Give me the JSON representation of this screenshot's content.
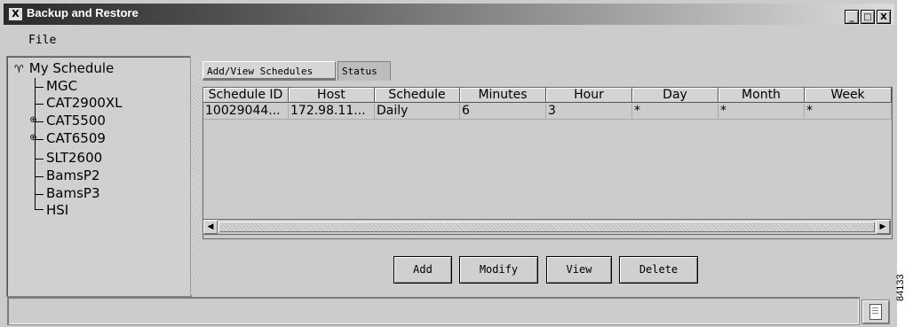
{
  "window": {
    "title": "Backup and Restore",
    "app_icon": "X",
    "controls": {
      "minimize": "_",
      "maximize": "□",
      "close": "X"
    }
  },
  "menubar": {
    "items": [
      {
        "label": "File"
      }
    ]
  },
  "tree": {
    "root": {
      "label": "My Schedule",
      "icon": "folder-open-icon"
    },
    "children": [
      {
        "label": "MGC",
        "expandable": false
      },
      {
        "label": "CAT2900XL",
        "expandable": false
      },
      {
        "label": "CAT5500",
        "expandable": true
      },
      {
        "label": "CAT6509",
        "expandable": true
      },
      {
        "label": "SLT2600",
        "expandable": false
      },
      {
        "label": "BamsP2",
        "expandable": false
      },
      {
        "label": "BamsP3",
        "expandable": false
      },
      {
        "label": "HSI",
        "expandable": false
      }
    ]
  },
  "tabs": [
    {
      "label": "Add/View Schedules",
      "active": true
    },
    {
      "label": "Status",
      "active": false
    }
  ],
  "table": {
    "columns": [
      "Schedule ID",
      "Host",
      "Schedule",
      "Minutes",
      "Hour",
      "Day",
      "Month",
      "Week"
    ],
    "rows": [
      [
        "10029044...",
        "172.98.11...",
        "Daily",
        "6",
        "3",
        "*",
        "*",
        "*"
      ]
    ]
  },
  "scrollbar": {
    "left_arrow": "◀",
    "right_arrow": "▶"
  },
  "buttons": {
    "add": "Add",
    "modify": "Modify",
    "view": "View",
    "delete": "Delete"
  },
  "statusbar": {
    "text": "",
    "icon": "document-icon"
  },
  "side_code": "84133"
}
